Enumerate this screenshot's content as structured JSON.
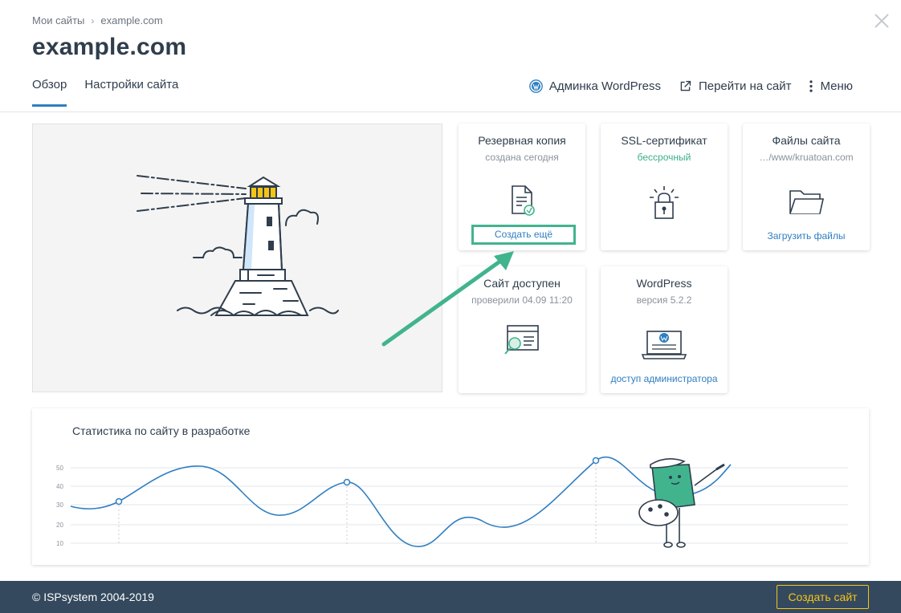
{
  "breadcrumb": {
    "root": "Мои сайты",
    "current": "example.com"
  },
  "page_title": "example.com",
  "tabs": [
    {
      "label": "Обзор",
      "active": true
    },
    {
      "label": "Настройки сайта",
      "active": false
    }
  ],
  "actions": {
    "wp_admin": "Админка WordPress",
    "go_to_site": "Перейти на сайт",
    "menu": "Меню"
  },
  "cards": {
    "backup": {
      "title": "Резервная копия",
      "subtitle": "создана сегодня",
      "link": "Создать ещё"
    },
    "ssl": {
      "title": "SSL-сертификат",
      "subtitle": "бессрочный"
    },
    "files": {
      "title": "Файлы сайта",
      "subtitle": "…/www/kruatoan.com",
      "link": "Загрузить файлы"
    },
    "availability": {
      "title": "Сайт доступен",
      "subtitle": "проверили 04.09 11:20"
    },
    "wordpress": {
      "title": "WordPress",
      "subtitle": "версия 5.2.2",
      "link": "доступ администратора"
    }
  },
  "stats": {
    "title": "Статистика по сайту в разработке",
    "y_ticks": [
      "50",
      "40",
      "30",
      "20",
      "10"
    ]
  },
  "footer": {
    "copyright": "© ISPsystem 2004-2019",
    "create_site": "Создать сайт"
  },
  "colors": {
    "accent": "#2f7ec1",
    "green": "#41b48e",
    "footer": "#34495e",
    "cta": "#f5c417"
  }
}
